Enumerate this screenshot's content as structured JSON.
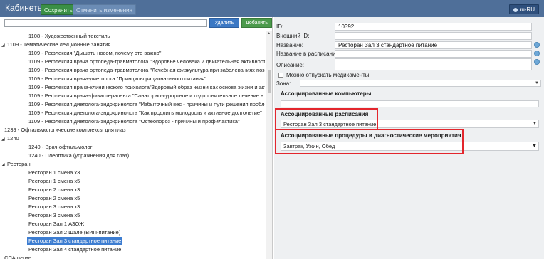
{
  "topbar": {
    "title": "Кабинеты",
    "save_label": "Сохранить",
    "cancel_label": "Отменить изменения",
    "lang_label": "ru-RU"
  },
  "left": {
    "delete_label": "Удалить",
    "add_label": "Добавить",
    "tree": [
      {
        "text": "1108 - Художественный текстиль",
        "indent": 2,
        "toggle": ""
      },
      {
        "text": "1109 - Тематические лекционные занятия",
        "indent": 1,
        "toggle": "◢"
      },
      {
        "text": "1109 - Рефлексия \"Дышать носом, почему это важно\"",
        "indent": 2,
        "toggle": ""
      },
      {
        "text": "1109 - Рефлексия врача ортопеда-травматолога \"Здоровье человека и двигательная активность\"",
        "indent": 2,
        "toggle": ""
      },
      {
        "text": "1109 - Рефлексия врача ортопеда-травматолога \"Лечебная физкультура при заболеваниях позвоноч",
        "indent": 2,
        "toggle": ""
      },
      {
        "text": "1109 - Рефлексия врача-диетолога \"Принципы рационального питания\"",
        "indent": 2,
        "toggle": ""
      },
      {
        "text": "1109 - Рефлексия врача-клинического психолога\"Здоровый образ жизни как основа жизни и активн",
        "indent": 2,
        "toggle": ""
      },
      {
        "text": "1109 - Рефлексия врача-физиотерапевта \"Санаторно-курортное и оздоровительное лечение в Siberi",
        "indent": 2,
        "toggle": ""
      },
      {
        "text": "1109 - Рефлексия диетолога-эндокринолога \"Избыточный вес - причины и пути решения проблемы",
        "indent": 2,
        "toggle": ""
      },
      {
        "text": "1109 - Рефлексия диетолога-эндокринолога \"Как продлить молодость и активное долголетие\"",
        "indent": 2,
        "toggle": ""
      },
      {
        "text": "1109 - Рефлексия диетолога-эндокринолога \"Остеопороз - причины и профилактика\"",
        "indent": 2,
        "toggle": ""
      },
      {
        "text": "1239 - Офтальмологические комплексы для глаз",
        "indent": 1,
        "toggle": ""
      },
      {
        "text": "1240",
        "indent": 1,
        "toggle": "◢"
      },
      {
        "text": "1240 - Врач-офтальмолог",
        "indent": 2,
        "toggle": ""
      },
      {
        "text": "1240 - Плеоптика (упражнения для глаз)",
        "indent": 2,
        "toggle": ""
      },
      {
        "text": "Ресторан",
        "indent": 1,
        "toggle": "◢"
      },
      {
        "text": "Ресторан 1 смена х3",
        "indent": 2,
        "toggle": ""
      },
      {
        "text": "Ресторан 1 смена х5",
        "indent": 2,
        "toggle": ""
      },
      {
        "text": "Ресторан 2 смена х3",
        "indent": 2,
        "toggle": ""
      },
      {
        "text": "Ресторан 2 смена х5",
        "indent": 2,
        "toggle": ""
      },
      {
        "text": "Ресторан 3 смена х3",
        "indent": 2,
        "toggle": ""
      },
      {
        "text": "Ресторан 3 смена х5",
        "indent": 2,
        "toggle": ""
      },
      {
        "text": "Ресторан Зал 1 АЗОЖ",
        "indent": 2,
        "toggle": ""
      },
      {
        "text": "Ресторан Зал 2 Шале (ВИП-питание)",
        "indent": 2,
        "toggle": ""
      },
      {
        "text": "Ресторан Зал 3 стандартное питание",
        "indent": 2,
        "toggle": "",
        "selected": true
      },
      {
        "text": "Ресторан Зал 4 стандартное питание",
        "indent": 2,
        "toggle": ""
      },
      {
        "text": "СПА центр",
        "indent": 1,
        "toggle": ""
      }
    ]
  },
  "form": {
    "id_label": "ID:",
    "id_value": "10392",
    "external_id_label": "Внешний ID:",
    "name_label": "Название:",
    "name_value": "Ресторан Зал 3 стандартное питание",
    "schedule_name_label": "Название в расписании:",
    "description_label": "Описание:",
    "meds_label": "Можно отпускать медикаменты",
    "zone_label": "Зона:"
  },
  "sections": {
    "computers_title": "Ассоциированные компьютеры",
    "schedules_title": "Ассоциированные расписания",
    "schedules_value": "Ресторан Зал 3 стандартное питание",
    "procedures_title": "Ассоциированные процедуры и диагностические мероприятия",
    "procedures_value": "Завтрак, Ужин, Обед"
  },
  "colors": {
    "topbar": "#4f6f99",
    "selected_row": "#3d7dd1",
    "highlight": "#e3262d",
    "save_button": "#3a8f46",
    "add_button": "#4c9a4c",
    "delete_button": "#3b78c4"
  }
}
